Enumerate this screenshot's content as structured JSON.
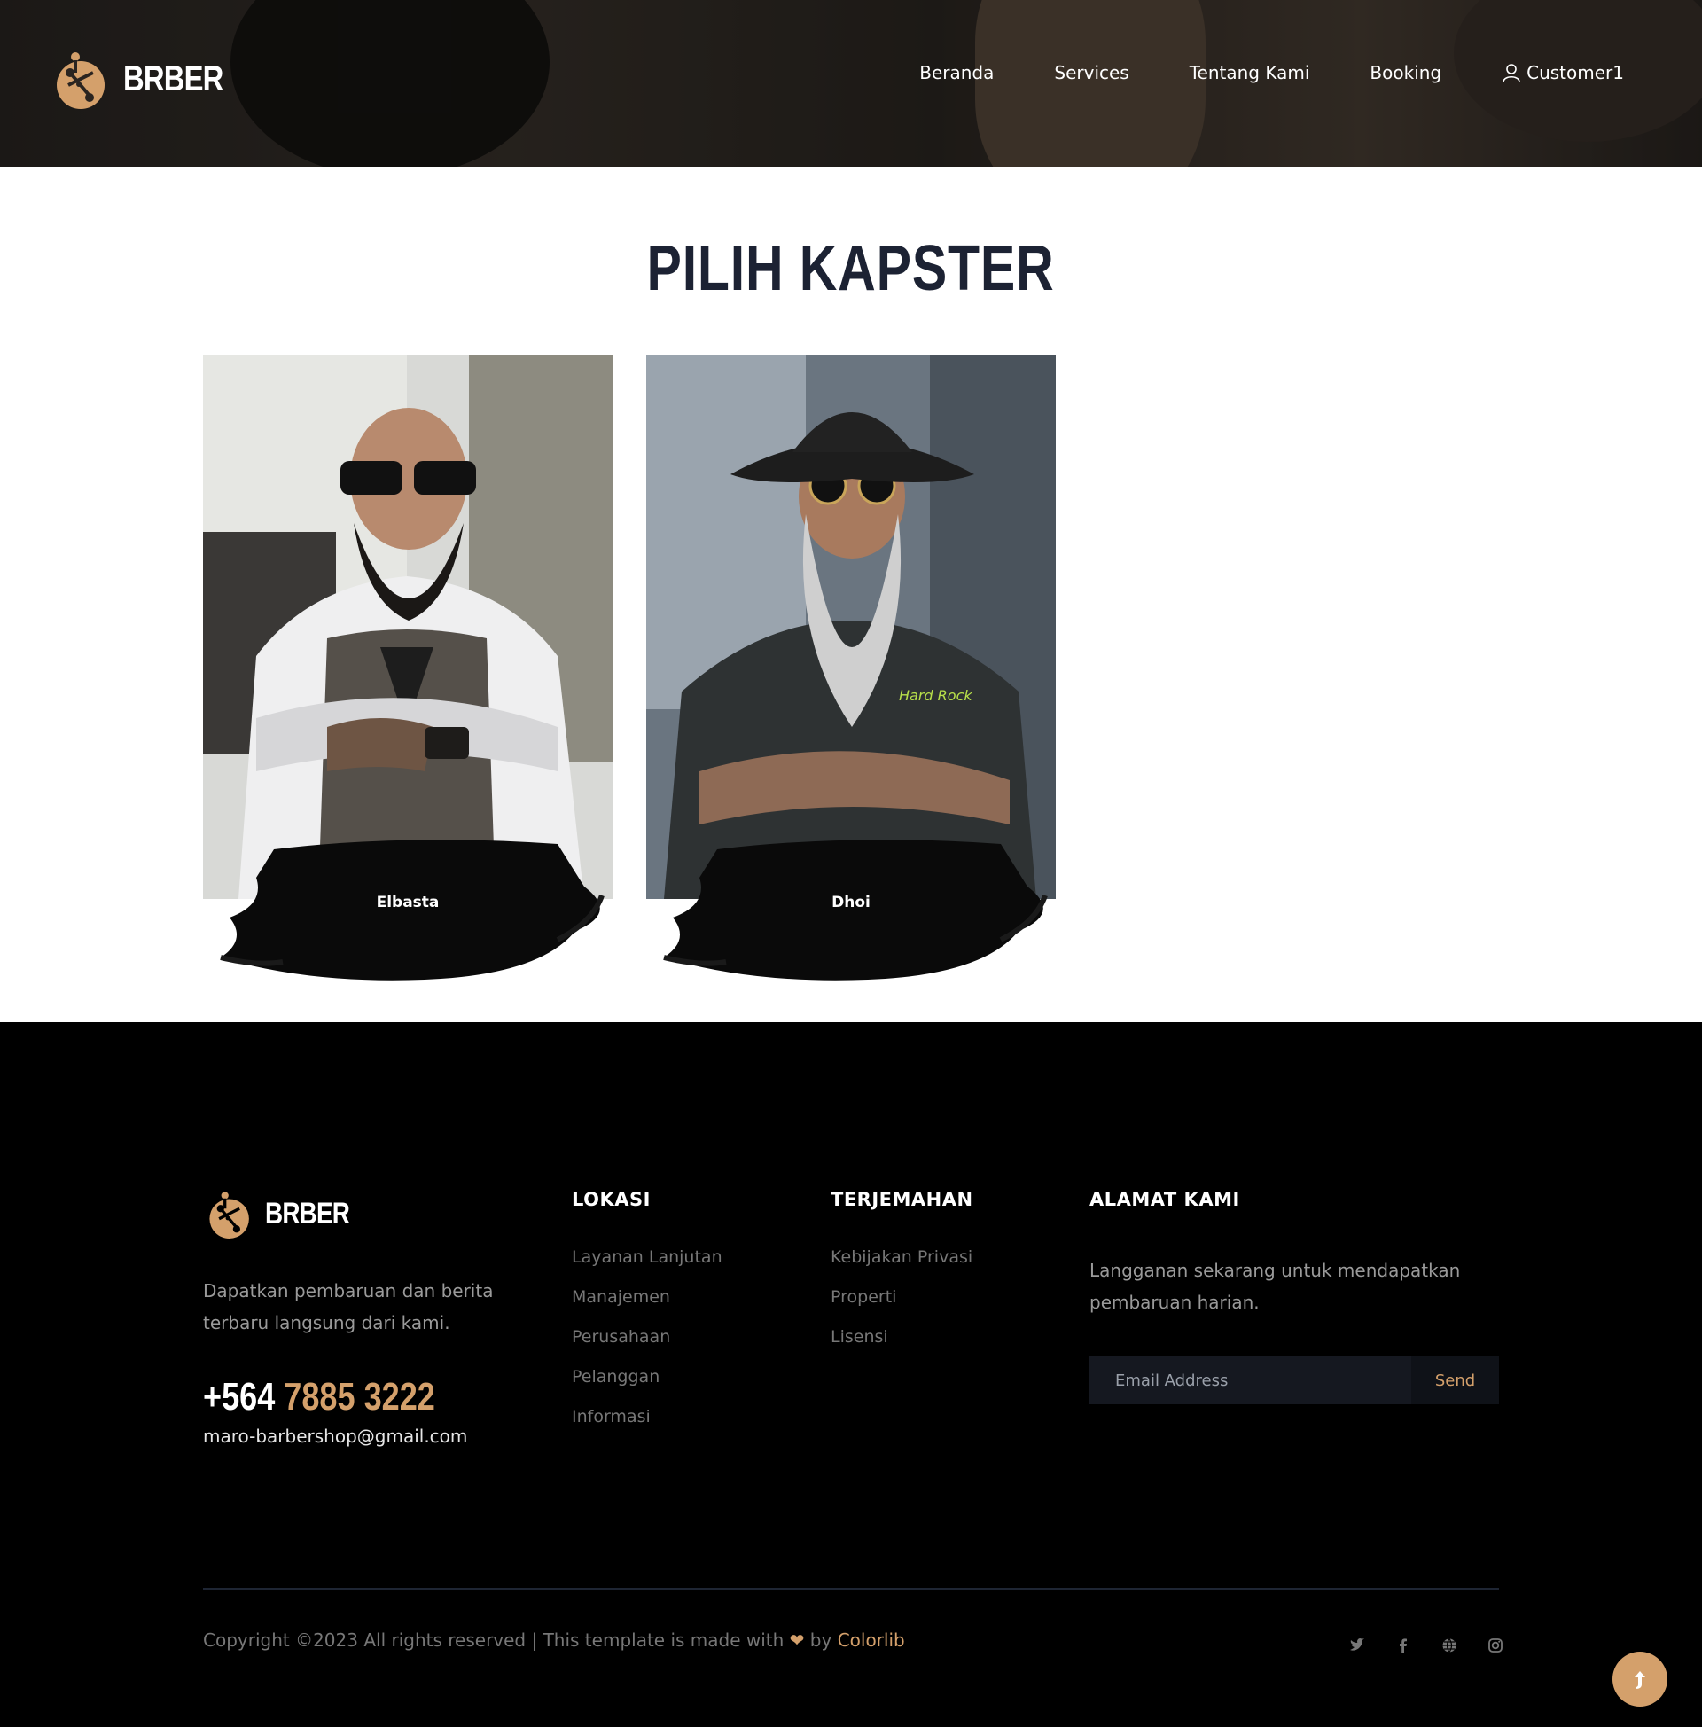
{
  "header": {
    "logo_text": "BRBER",
    "nav": [
      {
        "label": "Beranda"
      },
      {
        "label": "Services"
      },
      {
        "label": "Tentang Kami"
      },
      {
        "label": "Booking"
      },
      {
        "label": "Customer1",
        "icon": "user-icon"
      }
    ]
  },
  "main": {
    "title": "PILIH KAPSTER",
    "barbers": [
      {
        "name": "Elbasta"
      },
      {
        "name": "Dhoi"
      }
    ]
  },
  "footer": {
    "logo_text": "BRBER",
    "description": "Dapatkan pembaruan dan berita terbaru langsung dari kami.",
    "phone_prefix": "+564",
    "phone_number": "7885 3222",
    "email": "maro-barbershop@gmail.com",
    "columns": [
      {
        "title": "LOKASI",
        "links": [
          "Layanan Lanjutan",
          "Manajemen",
          "Perusahaan",
          "Pelanggan",
          "Informasi"
        ]
      },
      {
        "title": "TERJEMAHAN",
        "links": [
          "Kebijakan Privasi",
          "Properti",
          "Lisensi"
        ]
      }
    ],
    "subscribe": {
      "title": "ALAMAT KAMI",
      "text": "Langganan sekarang untuk mendapatkan pembaruan harian.",
      "placeholder": "Email Address",
      "button": "Send"
    },
    "copyright_pre": "Copyright ©2023 All rights reserved | This template is made with",
    "copyright_by": "by",
    "copyright_brand": "Colorlib",
    "social": [
      "twitter-icon",
      "facebook-icon",
      "globe-icon",
      "instagram-icon"
    ]
  },
  "colors": {
    "accent": "#d4a06b",
    "title": "#1c2233",
    "footer_bg": "#000000"
  }
}
